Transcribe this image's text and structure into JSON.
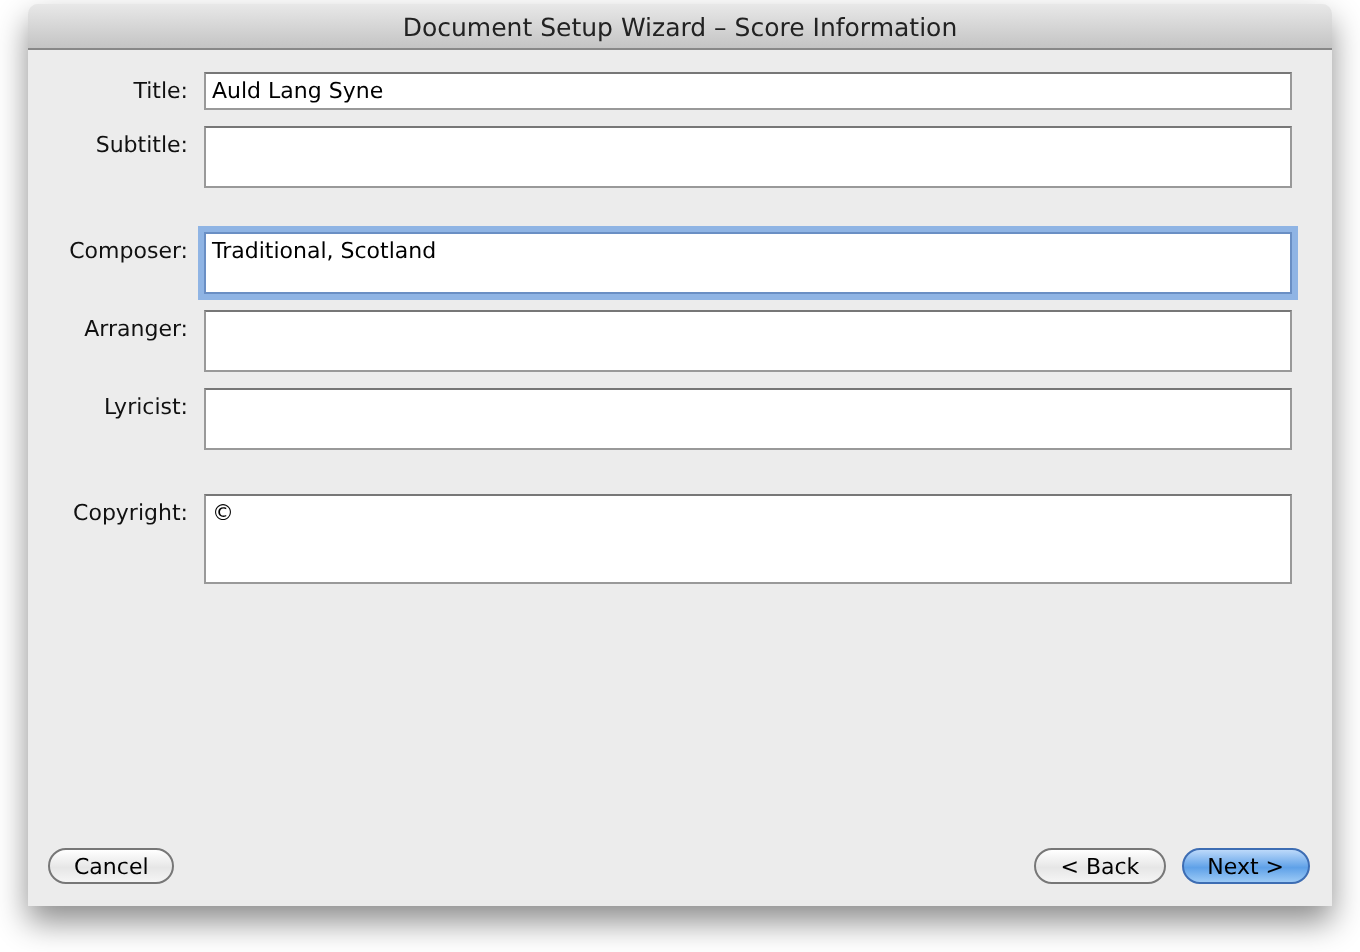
{
  "window": {
    "title": "Document Setup Wizard – Score Information"
  },
  "groups": [
    {
      "fields": [
        {
          "label": "Title:",
          "value": "Auld Lang Syne",
          "kind": "line",
          "focused": false
        },
        {
          "label": "Subtitle:",
          "kind": "box",
          "focused": false
        }
      ]
    },
    {
      "fields": [
        {
          "label": "Composer:",
          "value": "Traditional, Scotland",
          "kind": "box",
          "focused": true
        },
        {
          "label": "Arranger:",
          "kind": "box",
          "focused": false
        },
        {
          "label": "Lyricist:",
          "kind": "box",
          "focused": false
        }
      ]
    },
    {
      "fields": [
        {
          "label": "Copyright:",
          "value": "©",
          "kind": "tall",
          "focused": false
        }
      ]
    }
  ],
  "buttons": [
    {
      "label": "Cancel",
      "kind": "left",
      "default": false
    },
    {
      "label": "< Back",
      "kind": "right",
      "default": false
    },
    {
      "label": "Next >",
      "kind": "right",
      "default": true
    }
  ]
}
